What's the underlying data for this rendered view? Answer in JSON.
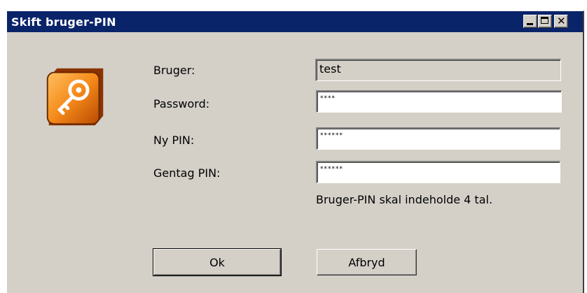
{
  "window": {
    "title": "Skift bruger-PIN",
    "controls": {
      "minimize_icon": "minimize-icon",
      "maximize_icon": "maximize-icon",
      "close_icon": "close-icon"
    }
  },
  "app_icon": {
    "name": "key-icon",
    "accent": "#f07a10"
  },
  "form": {
    "user_label": "Bruger:",
    "user_value": "test",
    "password_label": "Password:",
    "password_value": "****",
    "new_pin_label": "Ny PIN:",
    "new_pin_value": "******",
    "repeat_pin_label": "Gentag PIN:",
    "repeat_pin_value": "******",
    "hint": "Bruger-PIN skal indeholde 4 tal."
  },
  "buttons": {
    "ok_label": "Ok",
    "cancel_label": "Afbryd"
  },
  "colors": {
    "titlebar": "#0a246a",
    "window_bg": "#d4d0c8"
  }
}
